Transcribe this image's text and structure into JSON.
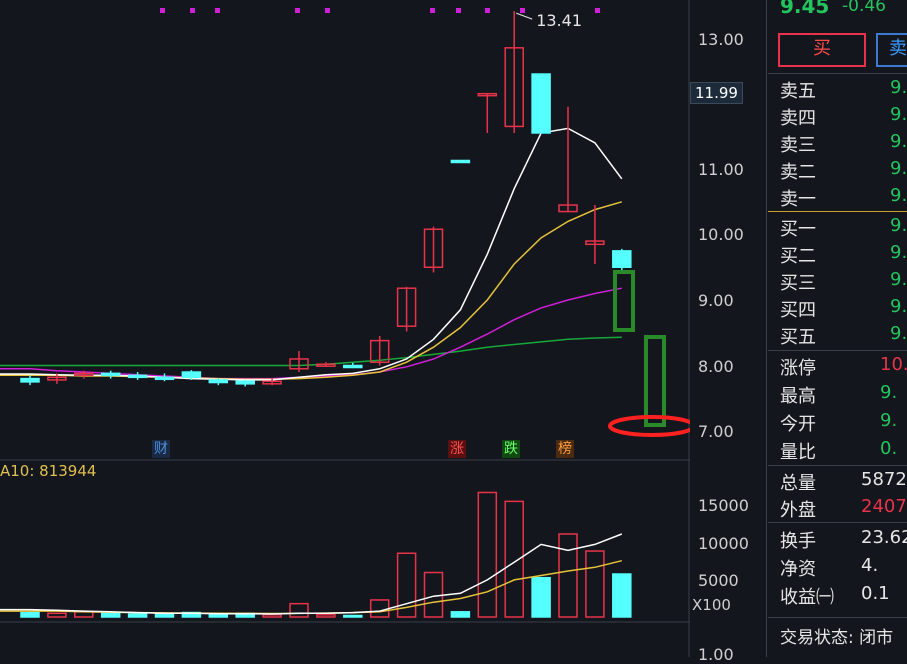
{
  "chart": {
    "price_axis": [
      "13.00",
      "12.00",
      "11.00",
      "10.00",
      "9.00",
      "8.00",
      "7.00"
    ],
    "current_price_tag": "11.99",
    "peak_label": "13.41",
    "event_labels": [
      "财",
      "涨",
      "跌",
      "榜"
    ],
    "volume_legend": "A10: 813944",
    "volume_axis": [
      "15000",
      "10000",
      "5000"
    ],
    "volume_unit": "X100",
    "bottom_axis": "1.00",
    "candles": [
      {
        "o": 7.8,
        "c": 7.75,
        "h": 7.85,
        "l": 7.7,
        "vol": 600
      },
      {
        "o": 7.78,
        "c": 7.82,
        "h": 7.88,
        "l": 7.72,
        "vol": 500
      },
      {
        "o": 7.85,
        "c": 7.88,
        "h": 7.92,
        "l": 7.8,
        "vol": 700
      },
      {
        "o": 7.88,
        "c": 7.85,
        "h": 7.92,
        "l": 7.8,
        "vol": 500
      },
      {
        "o": 7.85,
        "c": 7.82,
        "h": 7.9,
        "l": 7.78,
        "vol": 400
      },
      {
        "o": 7.82,
        "c": 7.8,
        "h": 7.88,
        "l": 7.76,
        "vol": 500
      },
      {
        "o": 7.9,
        "c": 7.82,
        "h": 7.93,
        "l": 7.78,
        "vol": 600
      },
      {
        "o": 7.78,
        "c": 7.74,
        "h": 7.8,
        "l": 7.7,
        "vol": 400
      },
      {
        "o": 7.76,
        "c": 7.72,
        "h": 7.78,
        "l": 7.68,
        "vol": 500
      },
      {
        "o": 7.72,
        "c": 7.76,
        "h": 7.8,
        "l": 7.7,
        "vol": 300
      },
      {
        "o": 7.95,
        "c": 8.1,
        "h": 8.22,
        "l": 7.9,
        "vol": 1800
      },
      {
        "o": 8.0,
        "c": 8.02,
        "h": 8.05,
        "l": 7.98,
        "vol": 300
      },
      {
        "o": 8.0,
        "c": 7.98,
        "h": 8.04,
        "l": 7.96,
        "vol": 200
      },
      {
        "o": 8.05,
        "c": 8.38,
        "h": 8.45,
        "l": 8.0,
        "vol": 2300
      },
      {
        "o": 8.6,
        "c": 9.18,
        "h": 9.2,
        "l": 8.52,
        "vol": 8600
      },
      {
        "o": 9.5,
        "c": 10.08,
        "h": 10.12,
        "l": 9.42,
        "vol": 6000
      },
      {
        "o": 11.13,
        "c": 11.1,
        "h": 11.13,
        "l": 11.1,
        "vol": 700
      },
      {
        "o": 12.15,
        "c": 12.15,
        "h": 12.15,
        "l": 11.55,
        "vol": 16800
      },
      {
        "o": 11.65,
        "c": 12.85,
        "h": 13.41,
        "l": 11.55,
        "vol": 15600
      },
      {
        "o": 12.45,
        "c": 11.55,
        "h": 12.45,
        "l": 11.55,
        "vol": 5300
      },
      {
        "o": 10.35,
        "c": 10.45,
        "h": 11.95,
        "l": 10.35,
        "vol": 11200
      },
      {
        "o": 9.85,
        "c": 9.9,
        "h": 10.45,
        "l": 9.55,
        "vol": 8900
      },
      {
        "o": 9.75,
        "c": 9.5,
        "h": 9.78,
        "l": 9.42,
        "vol": 5800
      }
    ],
    "ma_white": [
      7.87,
      7.86,
      7.85,
      7.85,
      7.84,
      7.82,
      7.8,
      7.79,
      7.78,
      7.78,
      7.82,
      7.86,
      7.88,
      7.95,
      8.1,
      8.4,
      8.85,
      9.7,
      10.7,
      11.55,
      11.62,
      11.4,
      10.85
    ],
    "ma_yellow": [
      7.85,
      7.85,
      7.84,
      7.84,
      7.83,
      7.82,
      7.81,
      7.8,
      7.79,
      7.79,
      7.8,
      7.82,
      7.85,
      7.9,
      8.05,
      8.28,
      8.58,
      9.0,
      9.55,
      9.95,
      10.2,
      10.38,
      10.5
    ],
    "ma_magenta": [
      7.95,
      7.92,
      7.9,
      7.88,
      7.86,
      7.84,
      7.82,
      7.8,
      7.8,
      7.8,
      7.82,
      7.84,
      7.86,
      7.9,
      7.98,
      8.1,
      8.28,
      8.48,
      8.7,
      8.88,
      9.0,
      9.1,
      9.18
    ],
    "ma_green": [
      8.0,
      8.0,
      8.0,
      8.0,
      8.0,
      8.0,
      8.0,
      8.0,
      8.0,
      8.0,
      8.0,
      8.02,
      8.05,
      8.08,
      8.12,
      8.17,
      8.22,
      8.28,
      8.32,
      8.36,
      8.4,
      8.42,
      8.43
    ],
    "vol_ma_white": [
      1000,
      900,
      800,
      700,
      600,
      500,
      500,
      450,
      450,
      400,
      500,
      500,
      600,
      800,
      1800,
      2800,
      3200,
      5000,
      7400,
      9800,
      9000,
      9800,
      11200,
      9500
    ],
    "vol_ma_yellow": [
      800,
      800,
      700,
      650,
      600,
      550,
      520,
      500,
      480,
      470,
      480,
      520,
      600,
      700,
      1300,
      2000,
      2500,
      3400,
      5000,
      5600,
      6200,
      6700,
      7600,
      8200
    ],
    "colors": {
      "up": "#e8334a",
      "down": "#55ffff",
      "ma5": "#ffffff",
      "ma10": "#e6c23a",
      "ma20": "#d01fd8",
      "ma60": "#18a83a",
      "annotation_green": "#2a8a2a",
      "annotation_red": "#ff2020"
    }
  },
  "panel": {
    "price": "9.45",
    "change": "-0.46",
    "buy_button": "买",
    "sell_button": "卖",
    "sell_levels": [
      {
        "label": "卖五",
        "value": "9."
      },
      {
        "label": "卖四",
        "value": "9."
      },
      {
        "label": "卖三",
        "value": "9."
      },
      {
        "label": "卖二",
        "value": "9."
      },
      {
        "label": "卖一",
        "value": "9."
      }
    ],
    "buy_levels": [
      {
        "label": "买一",
        "value": "9."
      },
      {
        "label": "买二",
        "value": "9."
      },
      {
        "label": "买三",
        "value": "9."
      },
      {
        "label": "买四",
        "value": "9."
      },
      {
        "label": "买五",
        "value": "9."
      }
    ],
    "stats": [
      {
        "label": "涨停",
        "value": "10.",
        "color": "#e8334a"
      },
      {
        "label": "最高",
        "value": "9.",
        "color": "#22c55e"
      },
      {
        "label": "今开",
        "value": "9.",
        "color": "#22c55e"
      },
      {
        "label": "量比",
        "value": "0.",
        "color": "#22c55e"
      }
    ],
    "stats2": [
      {
        "label": "总量",
        "value": "5872",
        "color": "#e6e6e6"
      },
      {
        "label": "外盘",
        "value": "2407",
        "color": "#e8334a"
      }
    ],
    "stats3": [
      {
        "label": "换手",
        "value": "23.62",
        "color": "#e6e6e6"
      },
      {
        "label": "净资",
        "value": "4.",
        "color": "#e6e6e6"
      },
      {
        "label": "收益㈠",
        "value": "0.1",
        "color": "#e6e6e6"
      }
    ],
    "status": "交易状态: 闭市"
  }
}
